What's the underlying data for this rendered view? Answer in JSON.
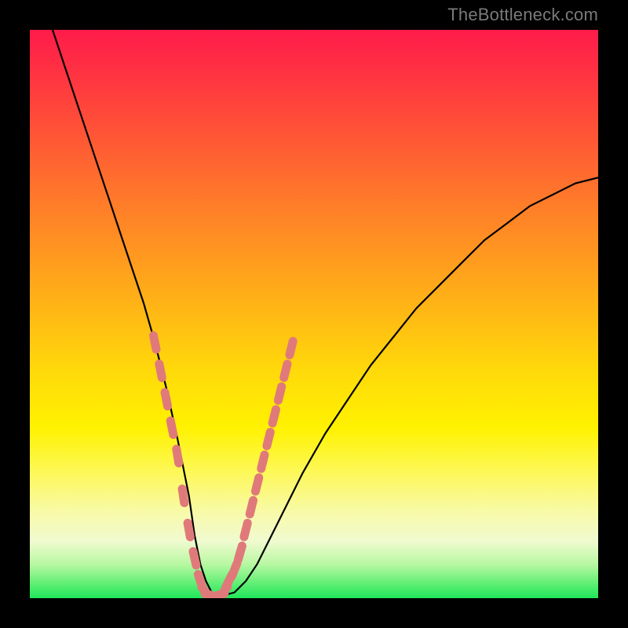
{
  "watermark": "TheBottleneck.com",
  "colors": {
    "curve": "#000000",
    "marker": "#e07a7a",
    "background_top": "#ff1b4a",
    "background_bottom": "#1fe65a",
    "frame": "#000000"
  },
  "chart_data": {
    "type": "line",
    "title": "",
    "xlabel": "",
    "ylabel": "",
    "xlim": [
      0,
      100
    ],
    "ylim": [
      0,
      100
    ],
    "grid": false,
    "series": [
      {
        "name": "bottleneck-curve",
        "x": [
          4,
          6,
          8,
          10,
          12,
          14,
          16,
          18,
          20,
          22,
          24,
          26,
          28,
          29,
          30,
          31,
          32,
          33,
          34,
          36,
          38,
          40,
          42,
          44,
          46,
          48,
          52,
          56,
          60,
          64,
          68,
          72,
          76,
          80,
          84,
          88,
          92,
          96,
          100
        ],
        "y": [
          100,
          94,
          88,
          82,
          76,
          70,
          64,
          58,
          52,
          45,
          37,
          28,
          18,
          11,
          6,
          3,
          1,
          0.5,
          0.5,
          1,
          3,
          6,
          10,
          14,
          18,
          22,
          29,
          35,
          41,
          46,
          51,
          55,
          59,
          63,
          66,
          69,
          71,
          73,
          74
        ]
      }
    ],
    "markers": {
      "name": "highlighted-points",
      "points": [
        {
          "x": 22,
          "y": 45
        },
        {
          "x": 23,
          "y": 40
        },
        {
          "x": 24,
          "y": 35
        },
        {
          "x": 25,
          "y": 30
        },
        {
          "x": 26,
          "y": 25
        },
        {
          "x": 27,
          "y": 18
        },
        {
          "x": 28,
          "y": 12
        },
        {
          "x": 29,
          "y": 7
        },
        {
          "x": 30,
          "y": 3
        },
        {
          "x": 31,
          "y": 1
        },
        {
          "x": 32,
          "y": 0.5
        },
        {
          "x": 33,
          "y": 0.5
        },
        {
          "x": 34,
          "y": 1
        },
        {
          "x": 35,
          "y": 3
        },
        {
          "x": 36,
          "y": 5
        },
        {
          "x": 37,
          "y": 8
        },
        {
          "x": 38,
          "y": 12
        },
        {
          "x": 39,
          "y": 16
        },
        {
          "x": 40,
          "y": 20
        },
        {
          "x": 41,
          "y": 24
        },
        {
          "x": 42,
          "y": 28
        },
        {
          "x": 43,
          "y": 32
        },
        {
          "x": 44,
          "y": 36
        },
        {
          "x": 45,
          "y": 40
        },
        {
          "x": 46,
          "y": 44
        }
      ]
    }
  }
}
